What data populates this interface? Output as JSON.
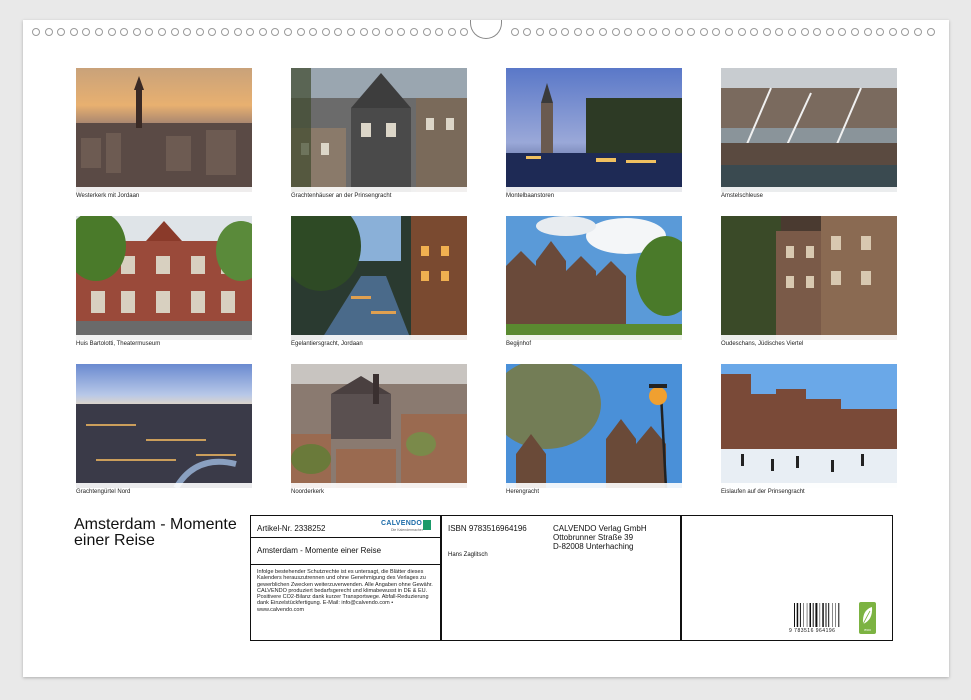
{
  "captions": [
    "Westerkerk mit Jordaan",
    "Grachtenhäuser an der Prinsengracht",
    "Montelbaanstoren",
    "Amstelschleuse",
    "Huis Bartolotti, Theatermuseum",
    "Egelantiersgracht, Jordaan",
    "Begijnhof",
    "Oudeschans, Jüdisches Viertel",
    "Grachtengürtel Nord",
    "Noorderkerk",
    "Herengracht",
    "Eislaufen auf der Prinsengracht"
  ],
  "title_lines": [
    "Amsterdam - Momente",
    "einer Reise"
  ],
  "info": {
    "article": "Artikel-Nr. 2338252",
    "publisher_logo": "CALVENDO",
    "publisher_logo_sub": "Die Kalendermacher",
    "calendar_title": "Amsterdam - Momente einer Reise",
    "isbn": "ISBN 9783516964196",
    "author": "Hans Zaglitsch",
    "publisher_name": "CALVENDO Verlag GmbH",
    "publisher_street": "Ottobrunner Straße 39",
    "publisher_city": "D-82008 Unterhaching",
    "legal": "Infolge bestehender Schutzrechte ist es untersagt, die Blätter dieses Kalenders herauszutrennen und ohne Genehmigung des Verlages zu gewerblichen Zwecken weiterzuverwenden. Alle Angaben ohne Gewähr. CALVENDO produziert bedarfsgerecht und klimabewusst in DE & EU. Positivere CO2-Bilanz dank kurzer Transportwege. Abfall-Reduzierung dank Einzelstückfertigung. E-Mail: info@calvendo.com • www.calvendo.com",
    "barcode_digits": "9 783516 964196",
    "eco_label": "eco"
  },
  "colors": {
    "accent": "#1a6aa8",
    "eco": "#7cb342"
  }
}
